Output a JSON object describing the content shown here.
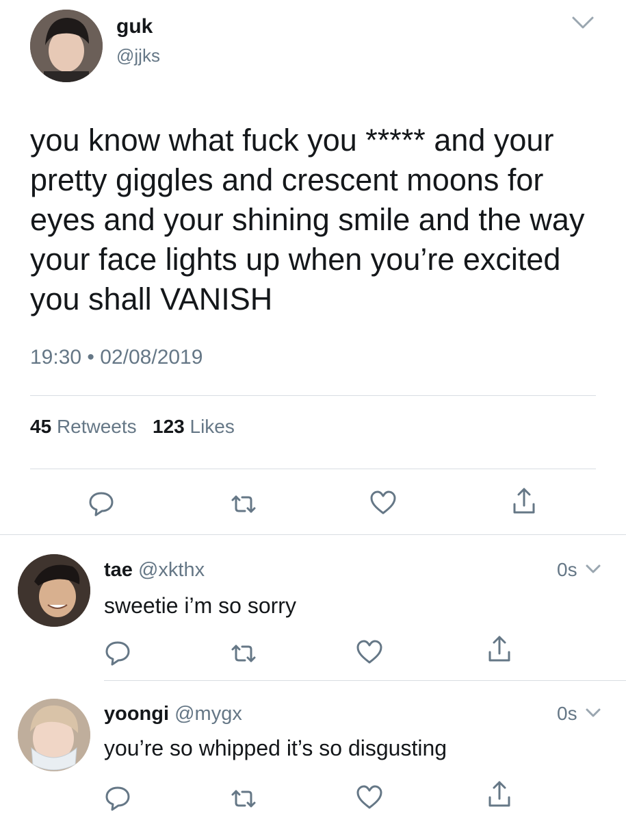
{
  "main_tweet": {
    "author_name": "guk",
    "author_handle": "@jjks",
    "text_lines": [
      "you know what fuck you ***** and your",
      "pretty giggles and crescent moons for",
      "eyes and your shining smile and the way",
      "your face lights up when you’re excited",
      "you shall VANISH"
    ],
    "time": "19:30",
    "separator": "•",
    "date": "02/08/2019",
    "retweets_count": "45",
    "retweets_label": "Retweets",
    "likes_count": "123",
    "likes_label": "Likes"
  },
  "replies": [
    {
      "name": "tae",
      "handle": "@xkthx",
      "time": "0s",
      "text": "sweetie i’m so sorry"
    },
    {
      "name": "yoongi",
      "handle": "@mygx",
      "time": "0s",
      "text": "you’re so whipped it’s so disgusting"
    }
  ],
  "icons": {
    "reply": "reply-bubble-icon",
    "retweet": "retweet-icon",
    "like": "heart-icon",
    "share": "share-icon",
    "caret": "chevron-down-icon"
  },
  "colors": {
    "text": "#14171a",
    "secondary": "#657786",
    "divider": "#d8dde2"
  }
}
